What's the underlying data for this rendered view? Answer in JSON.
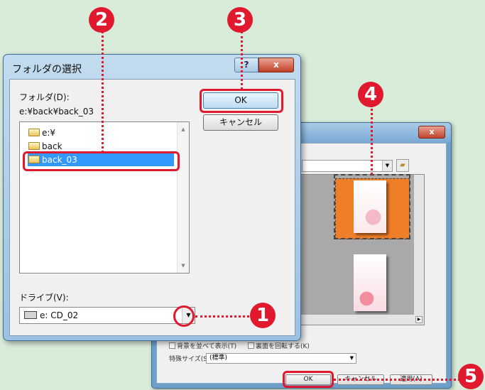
{
  "folder_dialog": {
    "title": "フォルダの選択",
    "help_label": "?",
    "close_label": "x",
    "folder_label": "フォルダ(D):",
    "current_path": "e:¥back¥back_03",
    "tree": [
      {
        "label": "e:¥"
      },
      {
        "label": "back"
      },
      {
        "label": "back_03",
        "selected": true
      }
    ],
    "ok_label": "OK",
    "cancel_label": "キャンセル",
    "drive_label": "ドライブ(V):",
    "drive_value": "e: CD_02"
  },
  "background_dialog": {
    "close_label": "x",
    "options": [
      {
        "label": "背景を並べて表示(T)"
      },
      {
        "label": "裏面を回転する(K)"
      }
    ],
    "size_label": "特殊サイズ(S)",
    "size_value": "(標準)",
    "ok_label": "OK",
    "cancel_label": "キャンセル",
    "apply_label": "適用(A)"
  },
  "callouts": [
    "1",
    "2",
    "3",
    "4",
    "5"
  ],
  "colors": {
    "callout": "#e0192f",
    "background": "#d9ebd9",
    "selection": "#3399ff"
  }
}
